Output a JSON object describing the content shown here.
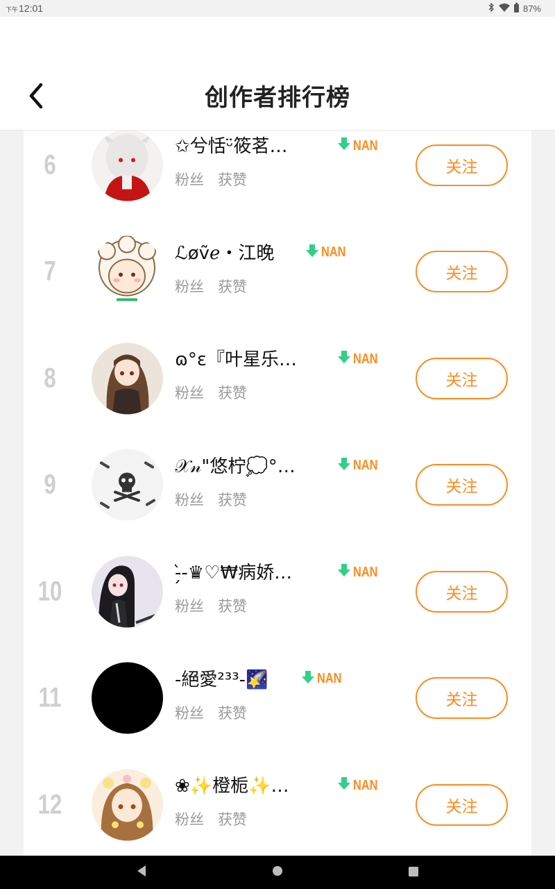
{
  "status_bar": {
    "ampm": "下午",
    "time": "12:01",
    "battery": "87%",
    "icons": [
      "bluetooth-icon",
      "wifi-icon",
      "battery-icon"
    ]
  },
  "header": {
    "title": "创作者排行榜",
    "back_icon": "chevron-left-icon"
  },
  "colors": {
    "accent": "#ff8a1f",
    "trend_arrow": "#2ed08a",
    "rank": "#cfcfcf",
    "muted": "#9a9a9a"
  },
  "creators": [
    {
      "rank": "6",
      "name": "✩兮恬ᵕ̈筱茗…",
      "trend": "NAN",
      "fans_label": "粉丝",
      "likes_label": "获赞",
      "follow_label": "关注"
    },
    {
      "rank": "7",
      "name": "ℒøṽℯ・江晚",
      "trend": "NAN",
      "fans_label": "粉丝",
      "likes_label": "获赞",
      "follow_label": "关注"
    },
    {
      "rank": "8",
      "name": "ɷ°ɛ『叶星乐…",
      "trend": "NAN",
      "fans_label": "粉丝",
      "likes_label": "获赞",
      "follow_label": "关注"
    },
    {
      "rank": "9",
      "name": "𝒳𝓃\"悠柠💭°…",
      "trend": "NAN",
      "fans_label": "粉丝",
      "likes_label": "获赞",
      "follow_label": "关注"
    },
    {
      "rank": "10",
      "name": "-̗̀-♛♡₩病娇…",
      "trend": "NAN",
      "fans_label": "粉丝",
      "likes_label": "获赞",
      "follow_label": "关注"
    },
    {
      "rank": "11",
      "name": "-絕愛²³³-🌠",
      "trend": "NAN",
      "fans_label": "粉丝",
      "likes_label": "获赞",
      "follow_label": "关注"
    },
    {
      "rank": "12",
      "name": "❀✨橙栀✨…",
      "trend": "NAN",
      "fans_label": "粉丝",
      "likes_label": "获赞",
      "follow_label": "关注"
    }
  ],
  "nav": {
    "back_icon": "nav-back-icon",
    "home_icon": "nav-home-icon",
    "recents_icon": "nav-recents-icon"
  }
}
